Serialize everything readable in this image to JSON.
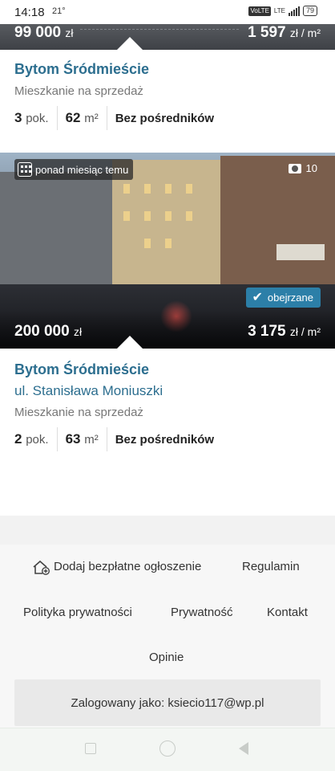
{
  "status_bar": {
    "time": "14:18",
    "temperature": "21°",
    "network": "LTE",
    "volte": "VoLTE",
    "battery": "79"
  },
  "listings": [
    {
      "price": "99 000",
      "price_unit": "zł",
      "price_per_m2": "1 597",
      "price_per_m2_unit": "zł / m²",
      "location": "Bytom Śródmieście",
      "type": "Mieszkanie na sprzedaż",
      "rooms": "3",
      "rooms_unit": "pok.",
      "area": "62",
      "area_unit": "m²",
      "agent": "Bez pośredników"
    },
    {
      "date_badge": "ponad miesiąc temu",
      "photo_count": "10",
      "seen_badge": "obejrzane",
      "price": "200 000",
      "price_unit": "zł",
      "price_per_m2": "3 175",
      "price_per_m2_unit": "zł / m²",
      "location": "Bytom Śródmieście",
      "street": "ul. Stanisława Moniuszki",
      "type": "Mieszkanie na sprzedaż",
      "rooms": "2",
      "rooms_unit": "pok.",
      "area": "63",
      "area_unit": "m²",
      "agent": "Bez pośredników"
    }
  ],
  "footer": {
    "add_listing": "Dodaj bezpłatne ogłoszenie",
    "terms": "Regulamin",
    "privacy_policy": "Polityka prywatności",
    "privacy": "Prywatność",
    "contact": "Kontakt",
    "opinions": "Opinie",
    "logged_in": "Zalogowany jako: ksiecio117@wp.pl"
  },
  "colors": {
    "accent": "#2c6e8f",
    "seen_badge": "#2c7fa8"
  }
}
